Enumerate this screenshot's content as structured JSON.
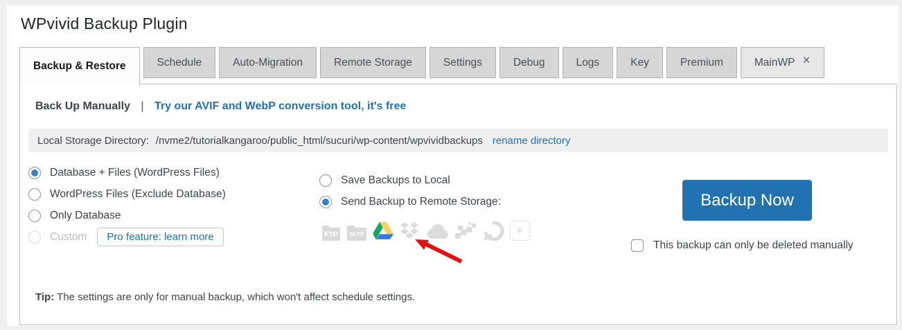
{
  "page": {
    "title": "WPvivid Backup Plugin"
  },
  "tabs": [
    {
      "label": "Backup & Restore",
      "active": true
    },
    {
      "label": "Schedule"
    },
    {
      "label": "Auto-Migration"
    },
    {
      "label": "Remote Storage"
    },
    {
      "label": "Settings"
    },
    {
      "label": "Debug"
    },
    {
      "label": "Logs"
    },
    {
      "label": "Key"
    },
    {
      "label": "Premium"
    },
    {
      "label": "MainWP",
      "closable": true,
      "close_glyph": "×"
    }
  ],
  "panel": {
    "header": {
      "title": "Back Up Manually",
      "separator": "|",
      "promo_link": "Try our AVIF and WebP conversion tool, it's free"
    },
    "directory": {
      "label": "Local Storage Directory:",
      "path": "/nvme2/tutorialkangaroo/public_html/sucuri/wp-content/wpvividbackups",
      "action": "rename directory"
    },
    "content_options": [
      {
        "label": "Database + Files (WordPress Files)",
        "selected": true
      },
      {
        "label": "WordPress Files (Exclude Database)",
        "selected": false
      },
      {
        "label": "Only Database",
        "selected": false
      },
      {
        "label": "Custom",
        "selected": false,
        "disabled": true,
        "pro_badge": "Pro feature: learn more"
      }
    ],
    "destination_options": [
      {
        "label": "Save Backups to Local",
        "selected": false
      },
      {
        "label": "Send Backup to Remote Storage:",
        "selected": true
      }
    ],
    "storages": [
      {
        "name": "ftp",
        "label": "FTP"
      },
      {
        "name": "sftp",
        "label": "SFTP"
      },
      {
        "name": "google-drive",
        "selected": true
      },
      {
        "name": "dropbox"
      },
      {
        "name": "onedrive"
      },
      {
        "name": "amazon-s3"
      },
      {
        "name": "digitalocean"
      },
      {
        "name": "add-storage",
        "glyph": "+"
      }
    ],
    "backup_now_label": "Backup Now",
    "manual_delete_label": "This backup can only be deleted manually",
    "tip_label": "Tip:",
    "tip_text": " The settings are only for manual backup, which won't affect schedule settings."
  },
  "colors": {
    "accent_link": "#2271b1",
    "primary_button": "#2271b1",
    "radio_selected": "#3582c4",
    "annotation_arrow": "#e01313",
    "drive_green": "#11a861",
    "drive_yellow": "#ffcf63",
    "drive_blue": "#3777e3",
    "inactive_tab": "#d6d6d7",
    "panel_border": "#bcbec0"
  }
}
